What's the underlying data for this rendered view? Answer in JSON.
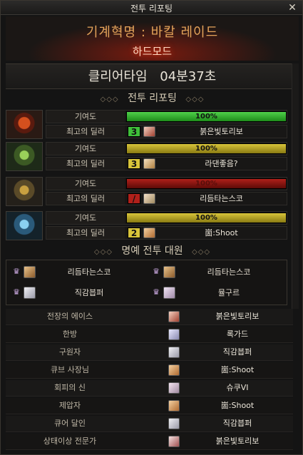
{
  "window": {
    "title": "전투 리포팅",
    "close_icon": "✕"
  },
  "banner": {
    "dungeon": "기계혁명 : 바칼 레이드",
    "mode": "하드모드"
  },
  "clear": {
    "label": "클리어타임",
    "time": "04분37초"
  },
  "report_heading": "전투 리포팅",
  "contribution_label": "기여도",
  "dealer_label": "최고의 딜러",
  "players": [
    {
      "contribution": "100%",
      "bar_color": "green",
      "contribution_level": 1.0,
      "rank": "3",
      "rank_color": "#3fbf3a",
      "dealer": "붉은빛토리보",
      "portrait_icon": "red-helmet-icon"
    },
    {
      "contribution": "100%",
      "bar_color": "yellow",
      "contribution_level": 1.0,
      "rank": "3",
      "rank_color": "#d8c43a",
      "dealer": "라댄좋음?",
      "portrait_icon": "green-helmet-icon"
    },
    {
      "contribution": "100%",
      "bar_color": "red",
      "contribution_level": 1.0,
      "rank": "/",
      "rank_color": "#b0201a",
      "dealer": "리듬타는스코",
      "portrait_icon": "gold-helmet-icon"
    },
    {
      "contribution": "100%",
      "bar_color": "yellow",
      "contribution_level": 1.0,
      "rank": "2",
      "rank_color": "#d8c43a",
      "dealer": "崮:Shoot",
      "portrait_icon": "blue-helmet-icon"
    }
  ],
  "honor_heading": "명예 전투 대원",
  "honor": [
    "리듬타는스코",
    "리듬타는스코",
    "직감븝퍼",
    "뮬구르"
  ],
  "awards": [
    {
      "title": "전장의 에이스",
      "name": "붉은빛토리보"
    },
    {
      "title": "한방",
      "name": "록가드"
    },
    {
      "title": "구원자",
      "name": "직감븝퍼"
    },
    {
      "title": "큐브 사장님",
      "name": "崮:Shoot"
    },
    {
      "title": "회피의 신",
      "name": "슈쿠VI"
    },
    {
      "title": "제압자",
      "name": "崮:Shoot"
    },
    {
      "title": "큐어 달인",
      "name": "직감븝퍼"
    },
    {
      "title": "상태이상 전문가",
      "name": "붉은빛토리보"
    }
  ],
  "colors": {
    "accent": "#e5a45a",
    "hard_mode_glow": "#ff3a10"
  }
}
